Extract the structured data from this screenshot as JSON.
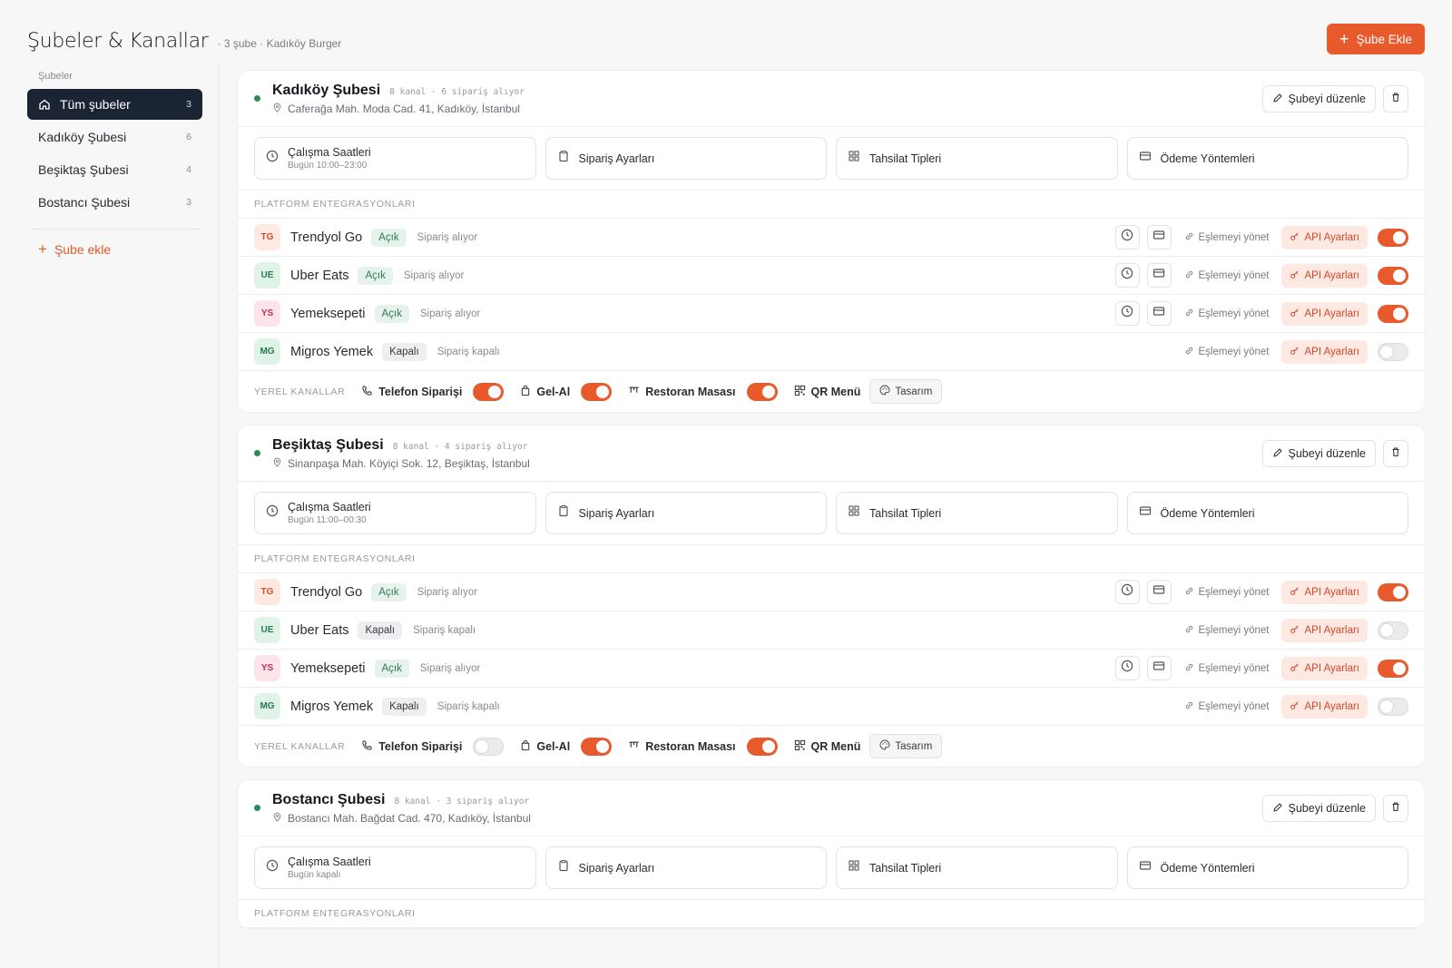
{
  "header": {
    "title": "Şubeler & Kanallar",
    "subtitle": "· 3 şube · Kadıköy Burger",
    "add_button": "Şube Ekle"
  },
  "sidebar": {
    "heading": "Şubeler",
    "items": [
      {
        "label": "Tüm şubeler",
        "count": "3"
      },
      {
        "label": "Kadıköy Şubesi",
        "count": "6"
      },
      {
        "label": "Beşiktaş Şubesi",
        "count": "4"
      },
      {
        "label": "Bostancı Şubesi",
        "count": "3"
      }
    ],
    "add_label": "Şube ekle"
  },
  "labels": {
    "edit_branch": "Şubeyi düzenle",
    "work_hours": "Çalışma Saatleri",
    "order_settings": "Sipariş Ayarları",
    "collection_types": "Tahsilat Tipleri",
    "payment_methods": "Ödeme Yöntemleri",
    "platform_section": "PLATFORM ENTEGRASYONLARI",
    "local_section": "YEREL KANALLAR",
    "manage_mapping": "Eşlemeyi yönet",
    "api_settings": "API Ayarları",
    "phone_order": "Telefon Siparişi",
    "pickup": "Gel-Al",
    "table": "Restoran Masası",
    "qr_menu": "QR Menü",
    "design": "Tasarım"
  },
  "colors": {
    "accent": "#e85a2c",
    "active_nav": "#1a2433",
    "status_green": "#2e8b57"
  },
  "branches": [
    {
      "name": "Kadıköy Şubesi",
      "meta": "8 kanal · 6 sipariş alıyor",
      "address": "Caferağa Mah. Moda Cad. 41, Kadıköy, İstanbul",
      "hours": "Bugün 10:00–23:00",
      "platforms": [
        {
          "abbr": "TG",
          "name": "Trendyol Go",
          "badge": "Açık",
          "status": "Sipariş alıyor",
          "on": true
        },
        {
          "abbr": "UE",
          "name": "Uber Eats",
          "badge": "Açık",
          "status": "Sipariş alıyor",
          "on": true
        },
        {
          "abbr": "YS",
          "name": "Yemeksepeti",
          "badge": "Açık",
          "status": "Sipariş alıyor",
          "on": true
        },
        {
          "abbr": "MG",
          "name": "Migros Yemek",
          "badge": "Kapalı",
          "status": "Sipariş kapalı",
          "on": false
        }
      ],
      "local": {
        "phone": true,
        "pickup": true,
        "table": true
      }
    },
    {
      "name": "Beşiktaş Şubesi",
      "meta": "8 kanal · 4 sipariş alıyor",
      "address": "Sinanpaşa Mah. Köyiçi Sok. 12, Beşiktaş, İstanbul",
      "hours": "Bugün 11:00–00:30",
      "platforms": [
        {
          "abbr": "TG",
          "name": "Trendyol Go",
          "badge": "Açık",
          "status": "Sipariş alıyor",
          "on": true
        },
        {
          "abbr": "UE",
          "name": "Uber Eats",
          "badge": "Kapalı",
          "status": "Sipariş kapalı",
          "on": false
        },
        {
          "abbr": "YS",
          "name": "Yemeksepeti",
          "badge": "Açık",
          "status": "Sipariş alıyor",
          "on": true
        },
        {
          "abbr": "MG",
          "name": "Migros Yemek",
          "badge": "Kapalı",
          "status": "Sipariş kapalı",
          "on": false
        }
      ],
      "local": {
        "phone": false,
        "pickup": true,
        "table": true
      }
    },
    {
      "name": "Bostancı Şubesi",
      "meta": "8 kanal · 3 sipariş alıyor",
      "address": "Bostancı Mah. Bağdat Cad. 470, Kadıköy, İstanbul",
      "hours": "Bugün kapalı",
      "platforms": [],
      "local": null
    }
  ]
}
